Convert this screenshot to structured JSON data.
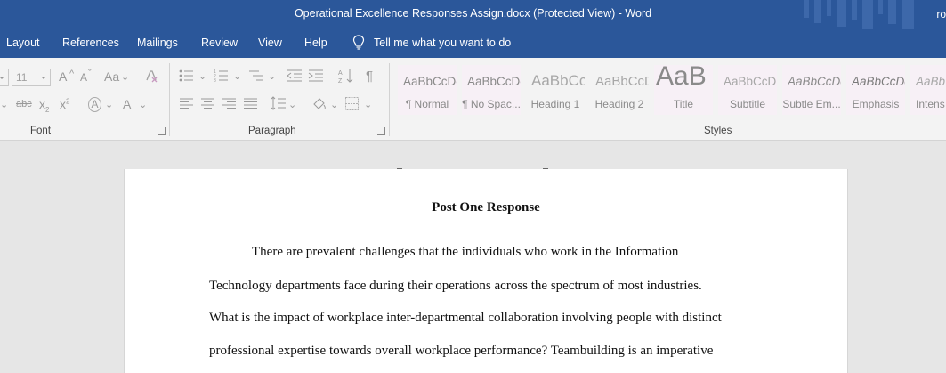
{
  "window": {
    "title": "Operational Excellence Responses Assign.docx (Protected View)  -  Word",
    "user": "ro"
  },
  "ribbon_tabs": [
    "Layout",
    "References",
    "Mailings",
    "Review",
    "View",
    "Help"
  ],
  "tell_me": "Tell me what you want to do",
  "font_group": {
    "label": "Font",
    "font_size": "11",
    "grow_font": "A",
    "shrink_font": "A",
    "change_case": "Aa",
    "strikethrough": "abc",
    "subscript": "x",
    "superscript": "x",
    "text_effects": "A",
    "font_color": "A"
  },
  "paragraph_group": {
    "label": "Paragraph",
    "show_marks": "¶"
  },
  "styles_group": {
    "label": "Styles",
    "items": [
      {
        "preview": "AaBbCcDc",
        "label": "¶ Normal"
      },
      {
        "preview": "AaBbCcDc",
        "label": "¶ No Spac..."
      },
      {
        "preview": "AaBbCc",
        "label": "Heading 1"
      },
      {
        "preview": "AaBbCcD",
        "label": "Heading 2"
      },
      {
        "preview": "AaB",
        "label": "Title"
      },
      {
        "preview": "AaBbCcD",
        "label": "Subtitle"
      },
      {
        "preview": "AaBbCcDc",
        "label": "Subtle Em..."
      },
      {
        "preview": "AaBbCcDc",
        "label": "Emphasis"
      },
      {
        "preview": "AaBb",
        "label": "Intens"
      }
    ]
  },
  "document": {
    "heading": "Post One Response",
    "lines": [
      "There are prevalent challenges that the individuals who work in the Information",
      "Technology departments face during their operations across the spectrum of most industries.",
      "What is the impact of workplace inter-departmental collaboration involving people with distinct",
      "professional expertise towards overall workplace performance? Teambuilding is an imperative"
    ]
  },
  "colors": {
    "title_bar": "#2b579a",
    "ribbon": "#f3f3f3",
    "canvas": "#e6e6e6"
  }
}
